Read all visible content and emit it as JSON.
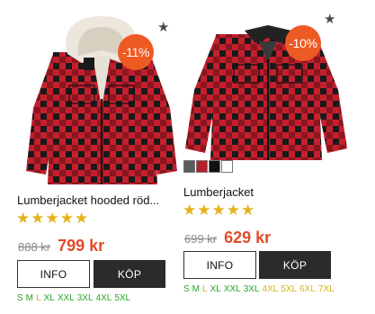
{
  "products": [
    {
      "title": "Lumberjacket hooded röd...",
      "discount": "-11%",
      "old_price": "888 kr",
      "new_price": "799 kr",
      "rating": 5,
      "info_label": "INFO",
      "buy_label": "KÖP",
      "sizes": [
        {
          "label": "S",
          "status": "in-stock"
        },
        {
          "label": "M",
          "status": "in-stock"
        },
        {
          "label": "L",
          "status": "low-stock"
        },
        {
          "label": "XL",
          "status": "in-stock"
        },
        {
          "label": "XXL",
          "status": "in-stock"
        },
        {
          "label": "3XL",
          "status": "in-stock"
        },
        {
          "label": "4XL",
          "status": "in-stock"
        },
        {
          "label": "5XL",
          "status": "in-stock"
        }
      ]
    },
    {
      "title": "Lumberjacket",
      "discount": "-10%",
      "old_price": "699 kr",
      "new_price": "629 kr",
      "rating": 5,
      "info_label": "INFO",
      "buy_label": "KÖP",
      "swatch_colors": [
        "#5b5b5b",
        "#b3202a",
        "#111111",
        "#ffffff"
      ],
      "sizes": [
        {
          "label": "S",
          "status": "in-stock"
        },
        {
          "label": "M",
          "status": "in-stock"
        },
        {
          "label": "L",
          "status": "low-stock"
        },
        {
          "label": "XL",
          "status": "in-stock"
        },
        {
          "label": "XXL",
          "status": "in-stock"
        },
        {
          "label": "3XL",
          "status": "in-stock"
        },
        {
          "label": "4XL",
          "status": "low-stock"
        },
        {
          "label": "5XL",
          "status": "low-stock"
        },
        {
          "label": "6XL",
          "status": "low-stock"
        },
        {
          "label": "7XL",
          "status": "low-stock"
        }
      ]
    }
  ],
  "colors": {
    "badge": "#ee5a24",
    "price": "#e24a2b",
    "star": "#e4b21c",
    "in_stock": "#2aa52a",
    "low_stock": "#d6b11c",
    "buy_bg": "#2b2b2b"
  },
  "icons": {
    "favorite": "star-icon",
    "rating": "star-icon"
  }
}
